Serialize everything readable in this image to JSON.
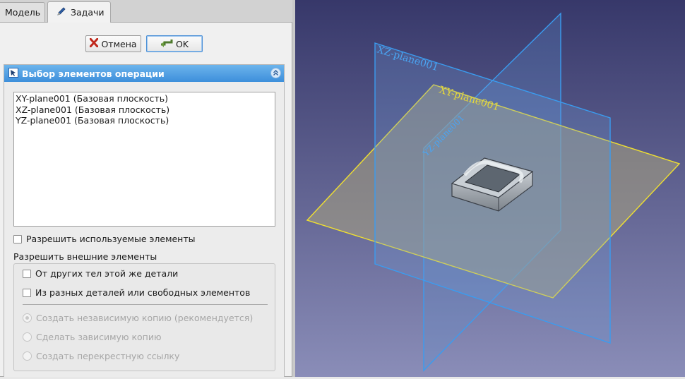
{
  "tabs": [
    {
      "label": "Модель"
    },
    {
      "label": "Задачи"
    }
  ],
  "buttons": {
    "cancel_label": "Отмена",
    "ok_label": "OK"
  },
  "task_panel": {
    "title": "Выбор элементов операции",
    "list_items": [
      "XY-plane001 (Базовая плоскость)",
      "XZ-plane001 (Базовая плоскость)",
      "YZ-plane001 (Базовая плоскость)"
    ],
    "allow_used_label": "Разрешить используемые элементы",
    "allow_external_label": "Разрешить внешние элементы",
    "external_options": {
      "same_part": "От других тел этой же детали",
      "other_parts": "Из разных деталей или свободных элементов"
    },
    "radio_options": [
      "Создать независимую копию (рекомендуется)",
      "Сделать зависимую копию",
      "Создать перекрестную ссылку"
    ]
  },
  "viewport": {
    "plane_labels": {
      "xz": "XZ-plane001",
      "xy": "XY-plane001",
      "yz": "YZ-plane001"
    },
    "colors": {
      "background_top": "#37386a",
      "background_bottom": "#8a8db8",
      "vertical_plane_edge": "#3a9cf0",
      "horizontal_plane_edge": "#f0e030",
      "horizontal_plane_fill": "#a7a280"
    }
  }
}
